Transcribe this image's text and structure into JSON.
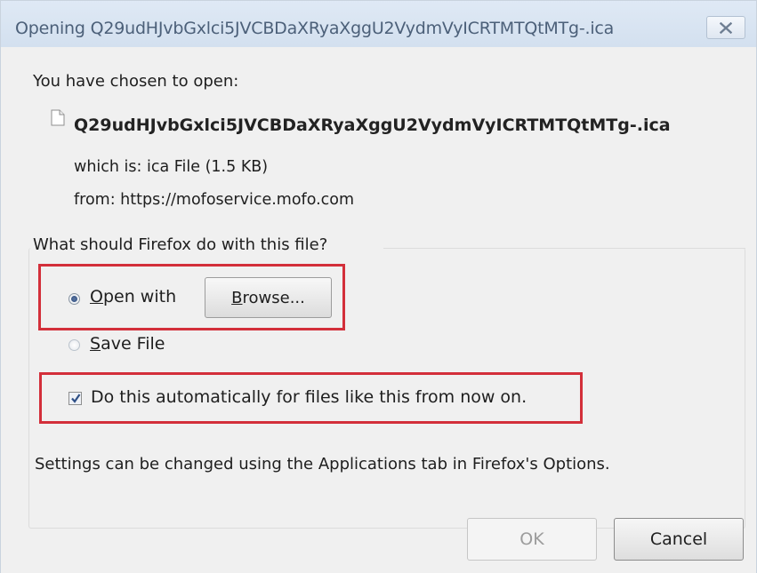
{
  "window": {
    "title": "Opening Q29udHJvbGxlci5JVCBDaXRyaXggU2VydmVyICRTMTQtMTg-.ica",
    "close_icon": "close-icon"
  },
  "file": {
    "chosen_label": "You have chosen to open:",
    "icon": "file-icon",
    "name": "Q29udHJvbGxlci5JVCBDaXRyaXggU2VydmVyICRTMTQtMTg-.ica",
    "type_line": "which is: ica File (1.5 KB)",
    "source_line": "from: https://mofoservice.mofo.com"
  },
  "action": {
    "question": "What should Firefox do with this file?",
    "open_with_label": "Open with",
    "open_with_selected": true,
    "browse_label": "Browse...",
    "save_file_label": "Save File",
    "save_file_selected": false,
    "auto_label": "Do this automatically for files like this from now on.",
    "auto_checked": true
  },
  "footer": {
    "settings_note": "Settings can be changed using the Applications tab in Firefox's Options.",
    "ok_label": "OK",
    "ok_enabled": false,
    "cancel_label": "Cancel"
  },
  "colors": {
    "highlight": "#d32f3a",
    "titlebar": "#d9e4f1",
    "dialog_bg": "#f0f0f0"
  }
}
